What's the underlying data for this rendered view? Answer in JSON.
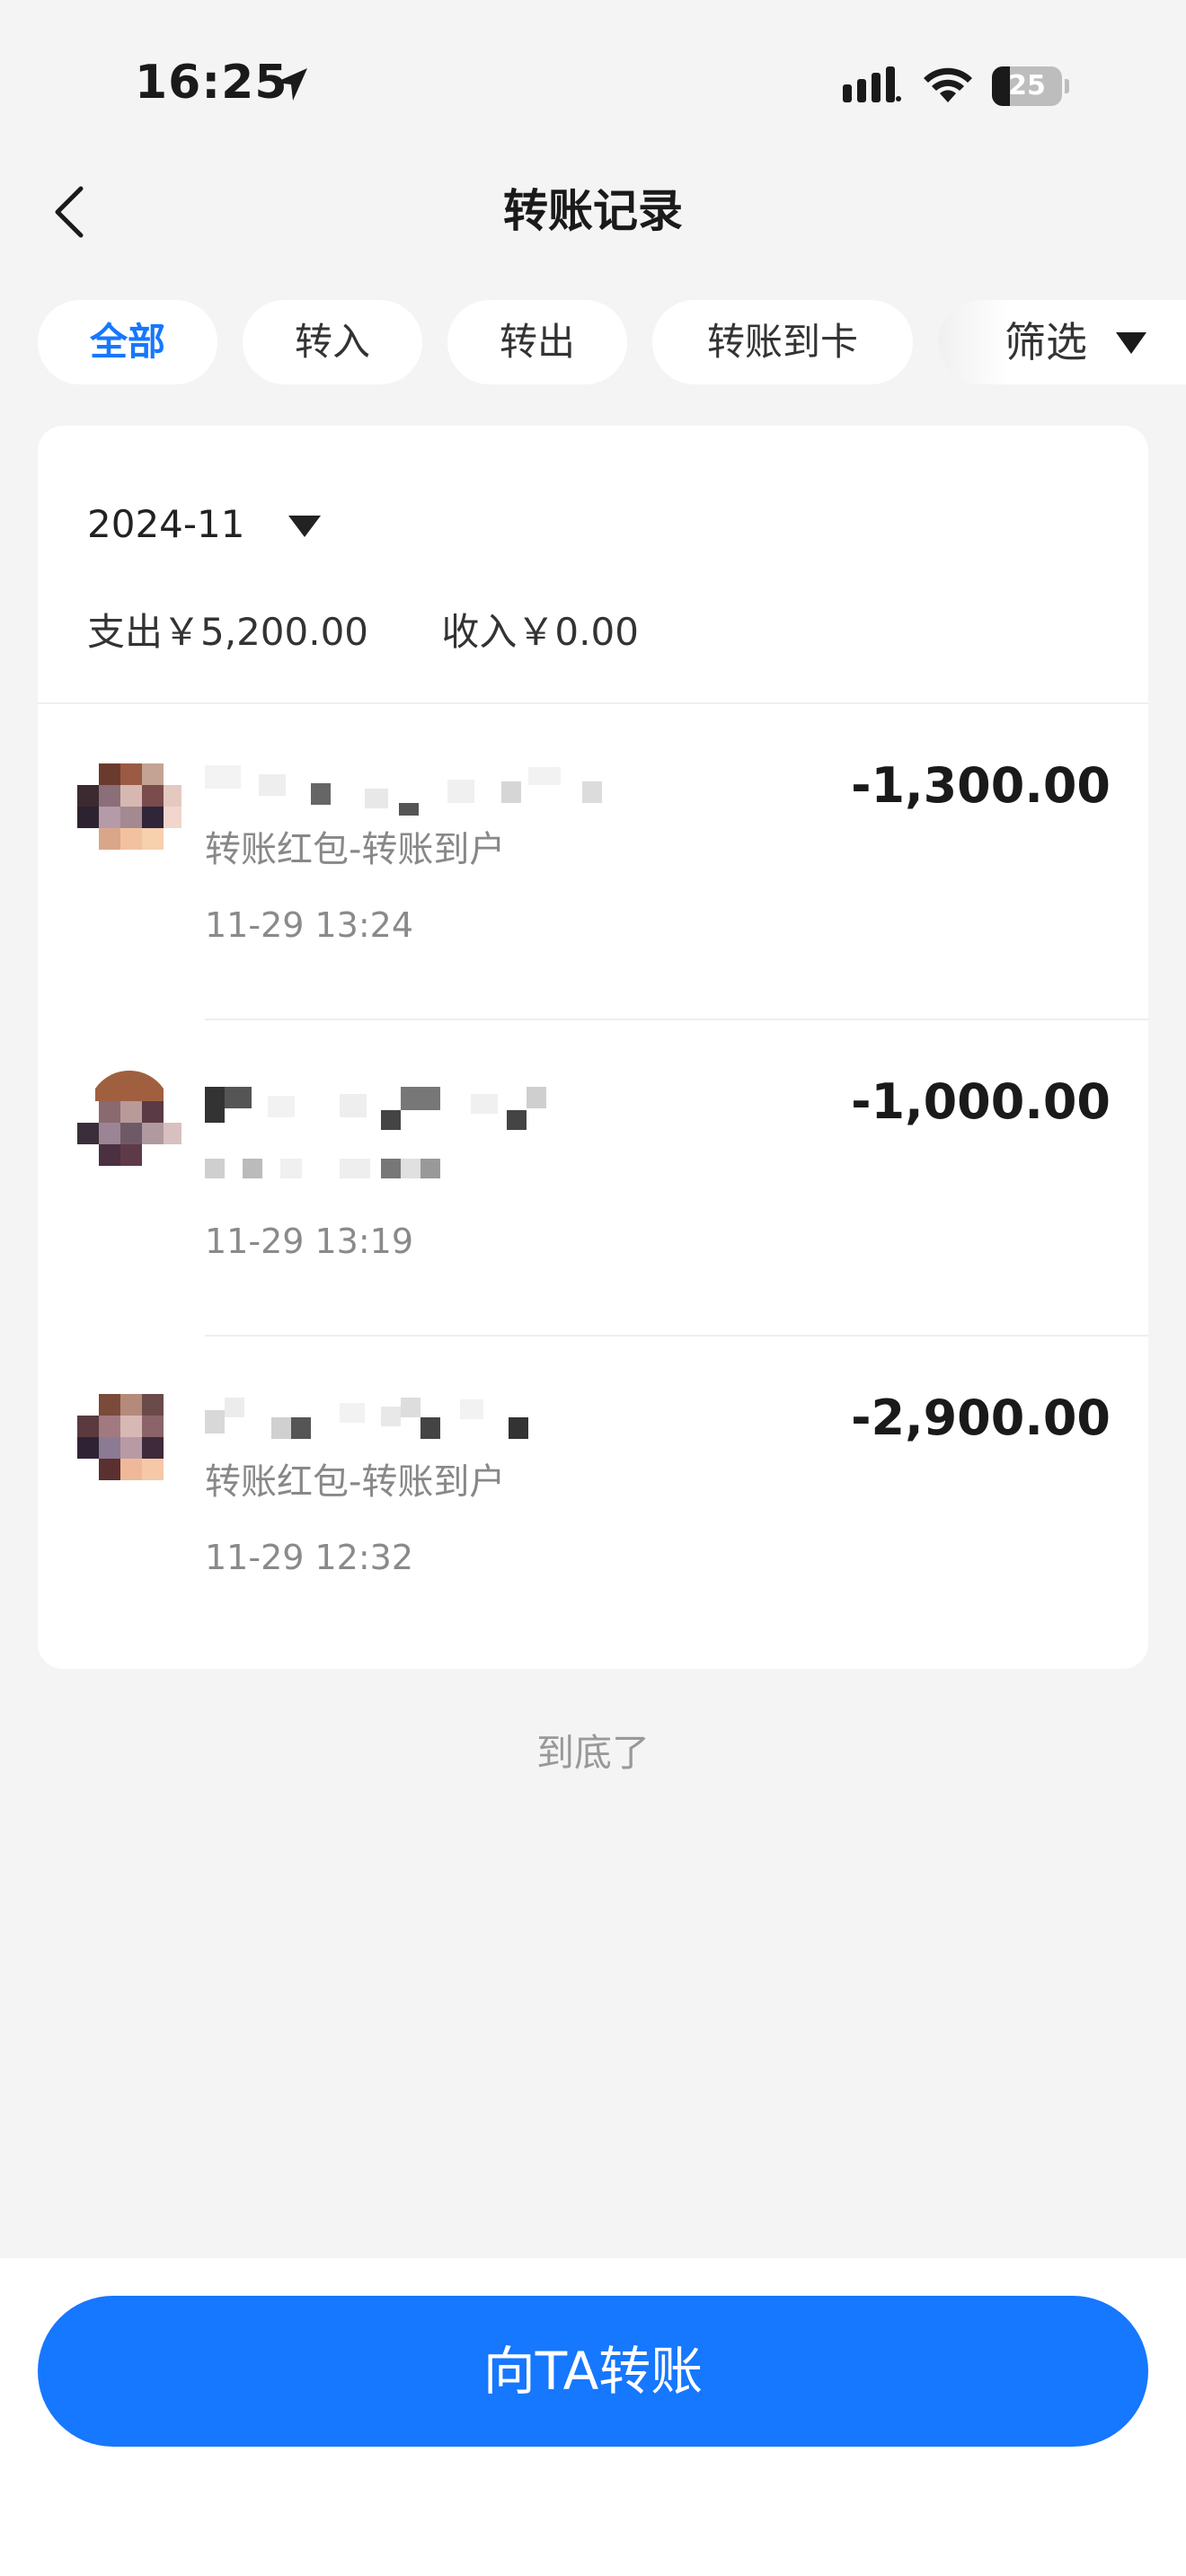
{
  "status_bar": {
    "time": "16:25",
    "battery": "25",
    "battery_level": 0.25
  },
  "nav": {
    "title": "转账记录"
  },
  "tabs": [
    {
      "label": "全部",
      "active": true
    },
    {
      "label": "转入",
      "active": false
    },
    {
      "label": "转出",
      "active": false
    },
    {
      "label": "转账到卡",
      "active": false
    }
  ],
  "filter": {
    "label": "筛选"
  },
  "month": "2024-11",
  "summary": {
    "expense": "支出￥5,200.00",
    "income": "收入￥0.00"
  },
  "records": [
    {
      "amount": "-1,300.00",
      "desc": "转账红包-转账到户",
      "time": "11-29 13:24"
    },
    {
      "amount": "-1,000.00",
      "desc": "",
      "time": "11-29 13:19"
    },
    {
      "amount": "-2,900.00",
      "desc": "转账红包-转账到户",
      "time": "11-29 12:32"
    }
  ],
  "end_text": "到底了",
  "transfer_button": "向TA转账",
  "colors": {
    "accent": "#1677ff",
    "background": "#f4f4f4"
  },
  "icons": [
    "location-arrow-icon",
    "signal-icon",
    "wifi-icon",
    "battery-icon",
    "back-chevron-icon",
    "caret-down-icon"
  ]
}
